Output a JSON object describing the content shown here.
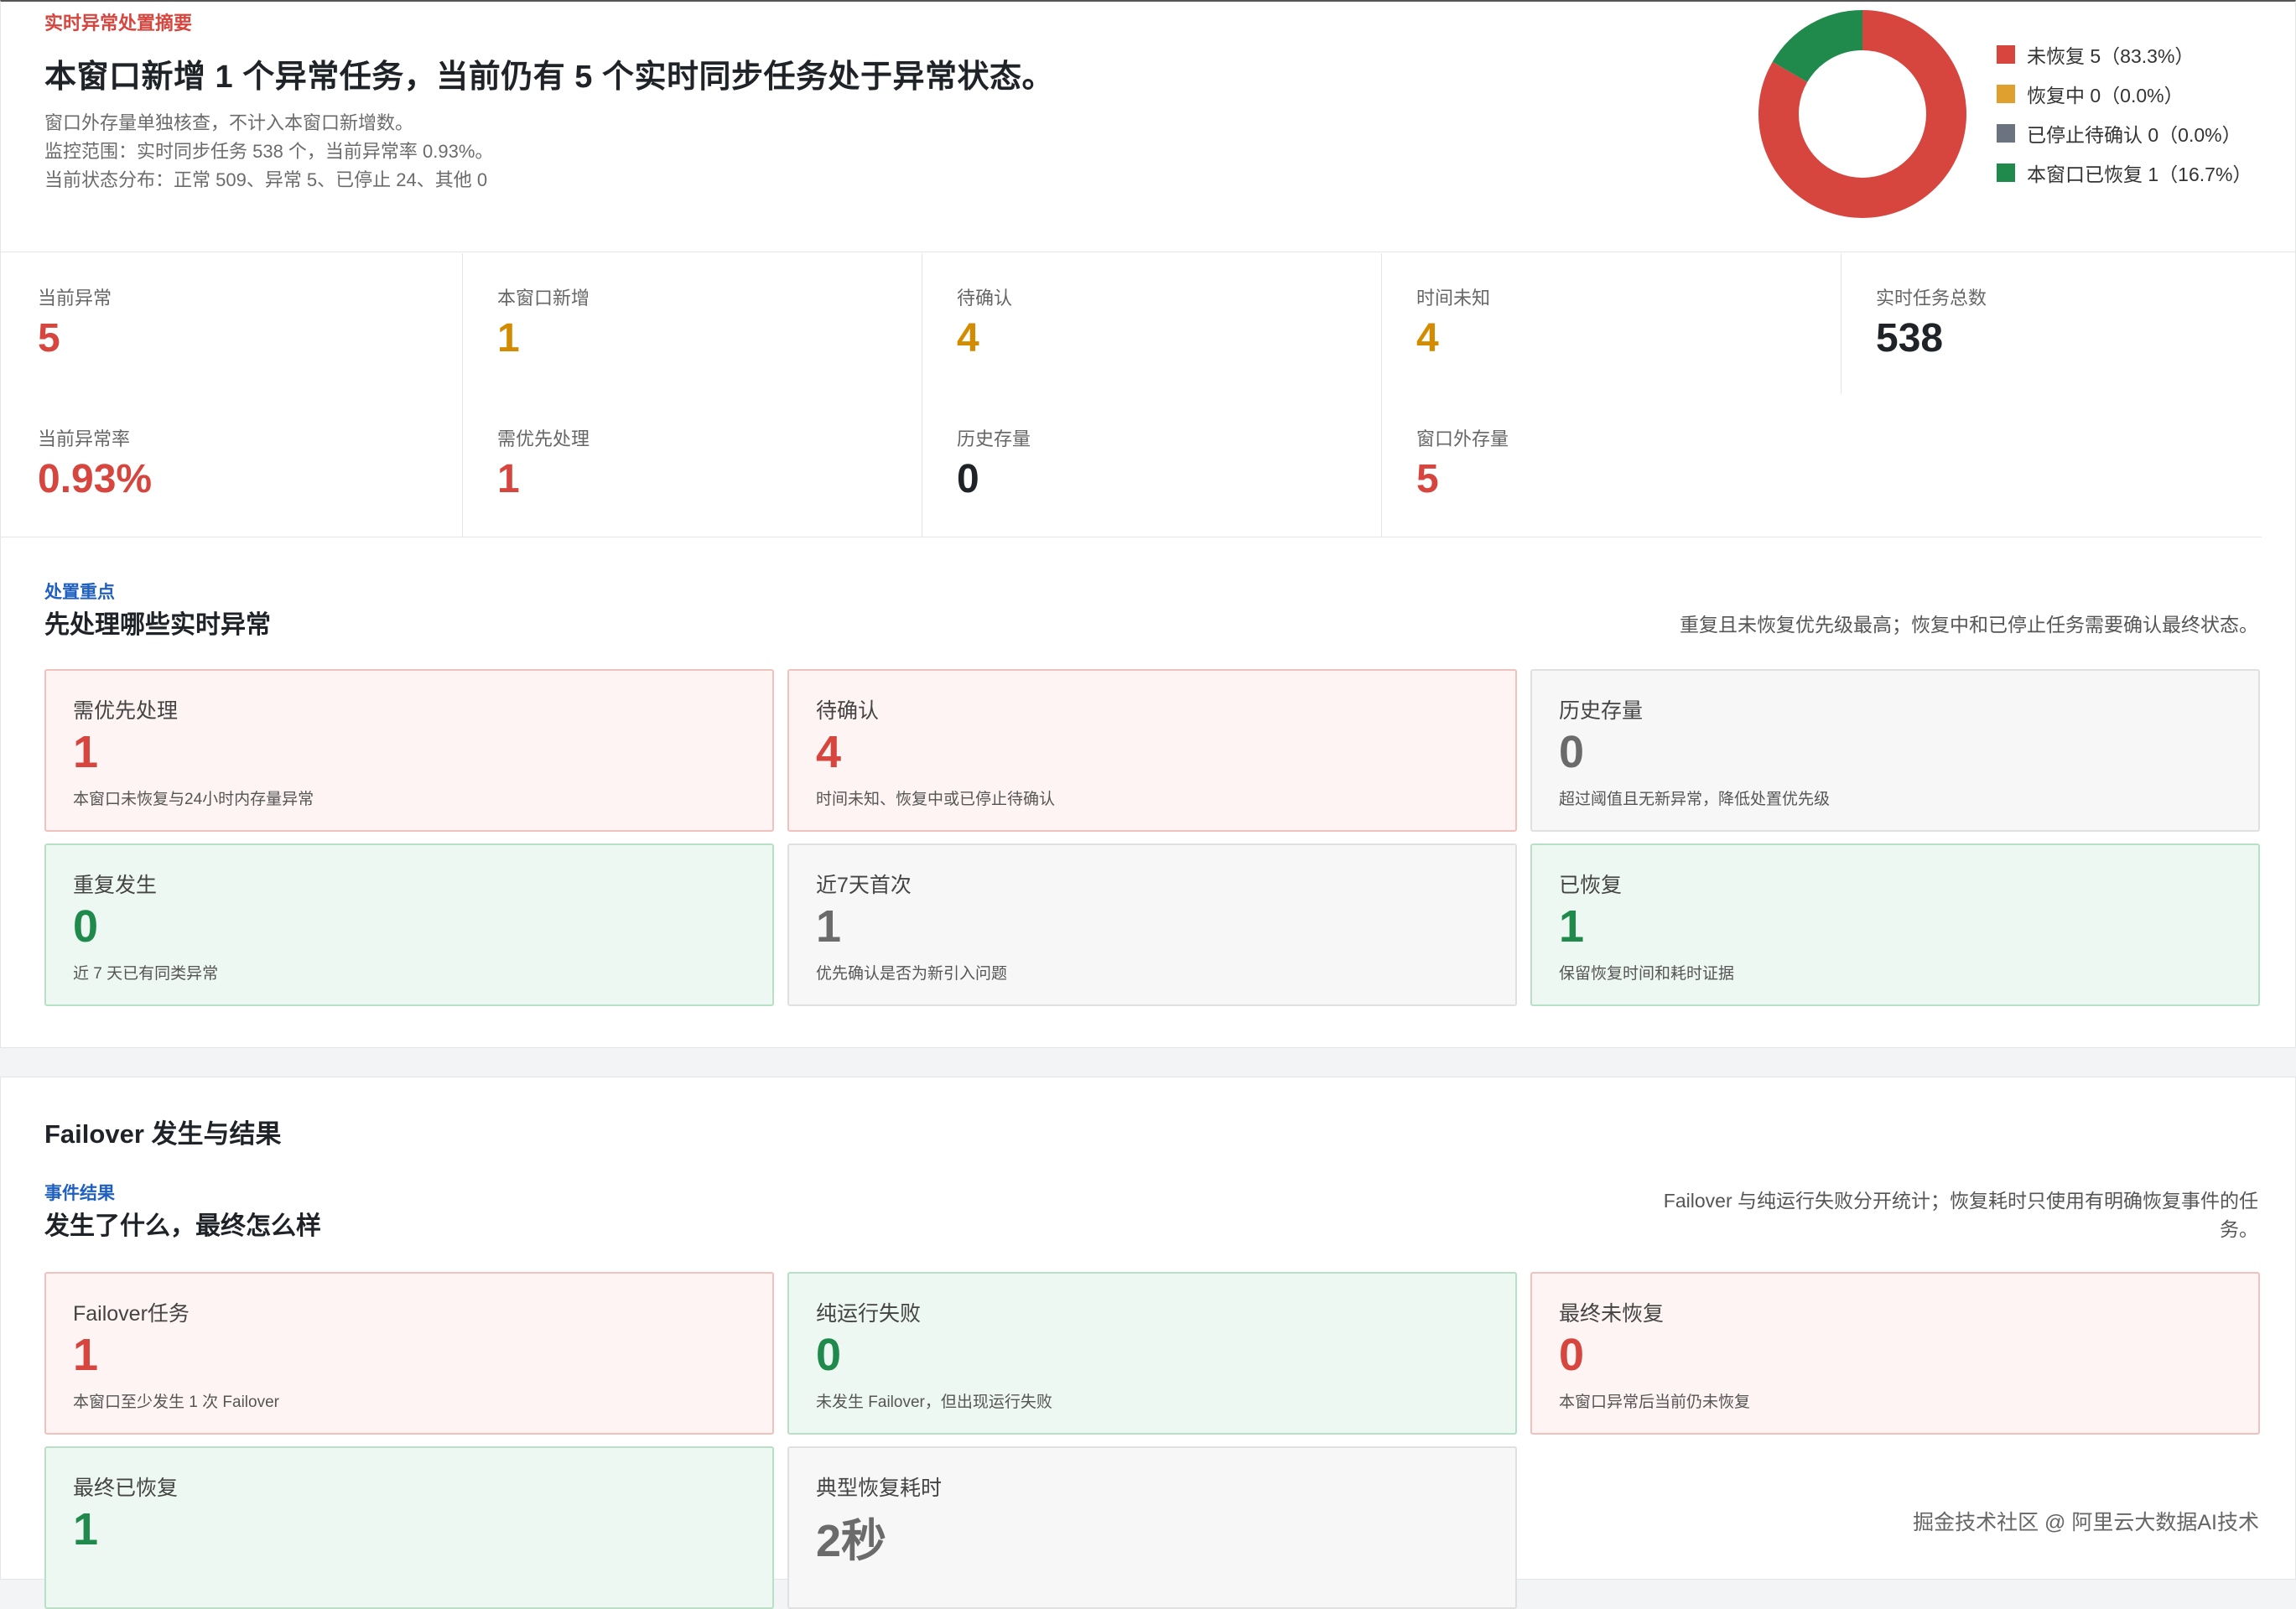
{
  "header": {
    "eyebrow": "实时异常处置摘要",
    "headline": "本窗口新增 1 个异常任务，当前仍有 5 个实时同步任务处于异常状态。",
    "sub_lines": [
      "窗口外存量单独核查，不计入本窗口新增数。",
      "监控范围：实时同步任务 538 个，当前异常率 0.93%。",
      "当前状态分布：正常 509、异常 5、已停止 24、其他 0"
    ]
  },
  "donut": {
    "legend": [
      {
        "label": "未恢复 5（83.3%）",
        "color": "#d6453e",
        "value": 5
      },
      {
        "label": "恢复中 0（0.0%）",
        "color": "#e0a030",
        "value": 0
      },
      {
        "label": "已停止待确认 0（0.0%）",
        "color": "#6b7280",
        "value": 0
      },
      {
        "label": "本窗口已恢复 1（16.7%）",
        "color": "#1f8a4c",
        "value": 1
      }
    ]
  },
  "metrics": [
    {
      "label": "当前异常",
      "value": "5"
    },
    {
      "label": "本窗口新增",
      "value": "1"
    },
    {
      "label": "待确认",
      "value": "4"
    },
    {
      "label": "时间未知",
      "value": "4"
    },
    {
      "label": "实时任务总数",
      "value": "538"
    },
    {
      "label": "当前异常率",
      "value": "0.93%"
    },
    {
      "label": "需优先处理",
      "value": "1"
    },
    {
      "label": "历史存量",
      "value": "0"
    },
    {
      "label": "窗口外存量",
      "value": "5"
    }
  ],
  "priority": {
    "eyebrow": "处置重点",
    "title": "先处理哪些实时异常",
    "note": "重复且未恢复优先级最高；恢复中和已停止任务需要确认最终状态。",
    "cards": [
      {
        "label": "需优先处理",
        "value": "1",
        "desc": "本窗口未恢复与24小时内存量异常"
      },
      {
        "label": "待确认",
        "value": "4",
        "desc": "时间未知、恢复中或已停止待确认"
      },
      {
        "label": "历史存量",
        "value": "0",
        "desc": "超过阈值且无新异常，降低处置优先级"
      },
      {
        "label": "重复发生",
        "value": "0",
        "desc": "近 7 天已有同类异常"
      },
      {
        "label": "近7天首次",
        "value": "1",
        "desc": "优先确认是否为新引入问题"
      },
      {
        "label": "已恢复",
        "value": "1",
        "desc": "保留恢复时间和耗时证据"
      }
    ]
  },
  "failover": {
    "section_title": "Failover 发生与结果",
    "eyebrow": "事件结果",
    "title": "发生了什么，最终怎么样",
    "note_lines": [
      "Failover 与纯运行失败分开统计；恢复耗时只使用有明确恢复事件的任",
      "务。"
    ],
    "cards": [
      {
        "label": "Failover任务",
        "value": "1",
        "desc": "本窗口至少发生 1 次 Failover"
      },
      {
        "label": "纯运行失败",
        "value": "0",
        "desc": "未发生 Failover，但出现运行失败"
      },
      {
        "label": "最终未恢复",
        "value": "0",
        "desc": "本窗口异常后当前仍未恢复"
      },
      {
        "label": "最终已恢复",
        "value": "1",
        "desc": ""
      },
      {
        "label": "典型恢复耗时",
        "value": "2秒",
        "desc": ""
      }
    ]
  },
  "watermark": "掘金技术社区 @ 阿里云大数据AI技术"
}
